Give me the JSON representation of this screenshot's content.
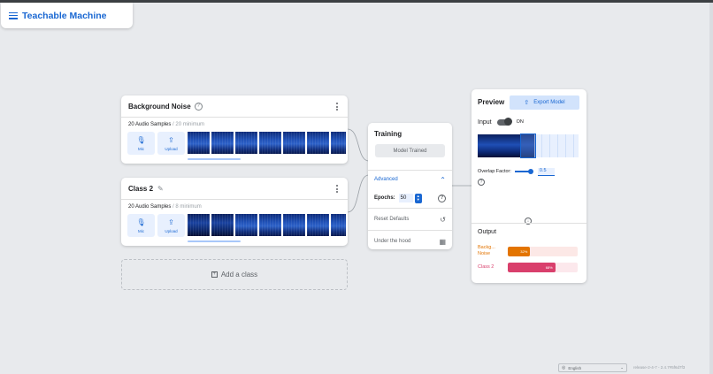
{
  "app": {
    "title": "Teachable Machine"
  },
  "classes": [
    {
      "name": "Background Noise",
      "samples_count": "20 Audio Samples",
      "samples_min": " / 20 minimum",
      "mic_label": "Mic",
      "upload_label": "Upload"
    },
    {
      "name": "Class 2",
      "samples_count": "20 Audio Samples",
      "samples_min": " / 8 minimum",
      "mic_label": "Mic",
      "upload_label": "Upload"
    }
  ],
  "add_class": {
    "label": "Add a class"
  },
  "training": {
    "title": "Training",
    "button": "Model Trained",
    "advanced": "Advanced",
    "epochs_label": "Epochs:",
    "epochs_value": "50",
    "reset": "Reset Defaults",
    "under_hood": "Under the hood"
  },
  "preview": {
    "title": "Preview",
    "export": "Export Model",
    "input_label": "Input",
    "toggle_state": "ON",
    "overlap_label": "Overlap Factor:",
    "overlap_value": "0.5",
    "output_title": "Output",
    "outputs": [
      {
        "label": "Backg... Noise",
        "value": "32%",
        "fraction": 0.32,
        "color": "#e37400",
        "track": "#fce8e6"
      },
      {
        "label": "Class 2",
        "value": "68%",
        "fraction": 0.68,
        "color": "#d93f6c",
        "track": "#fce8ec"
      }
    ]
  },
  "footer": {
    "language": "English",
    "version": "release-2-4-7 - 2.4.7#5f6d7f3"
  },
  "icons": [
    "menu-icon",
    "help-icon",
    "pencil-icon",
    "kebab-menu-icon",
    "mic-icon",
    "upload-icon",
    "plus-box-icon",
    "chevron-up-icon",
    "history-icon",
    "chart-icon",
    "export-icon",
    "expand-icon",
    "globe-icon"
  ]
}
